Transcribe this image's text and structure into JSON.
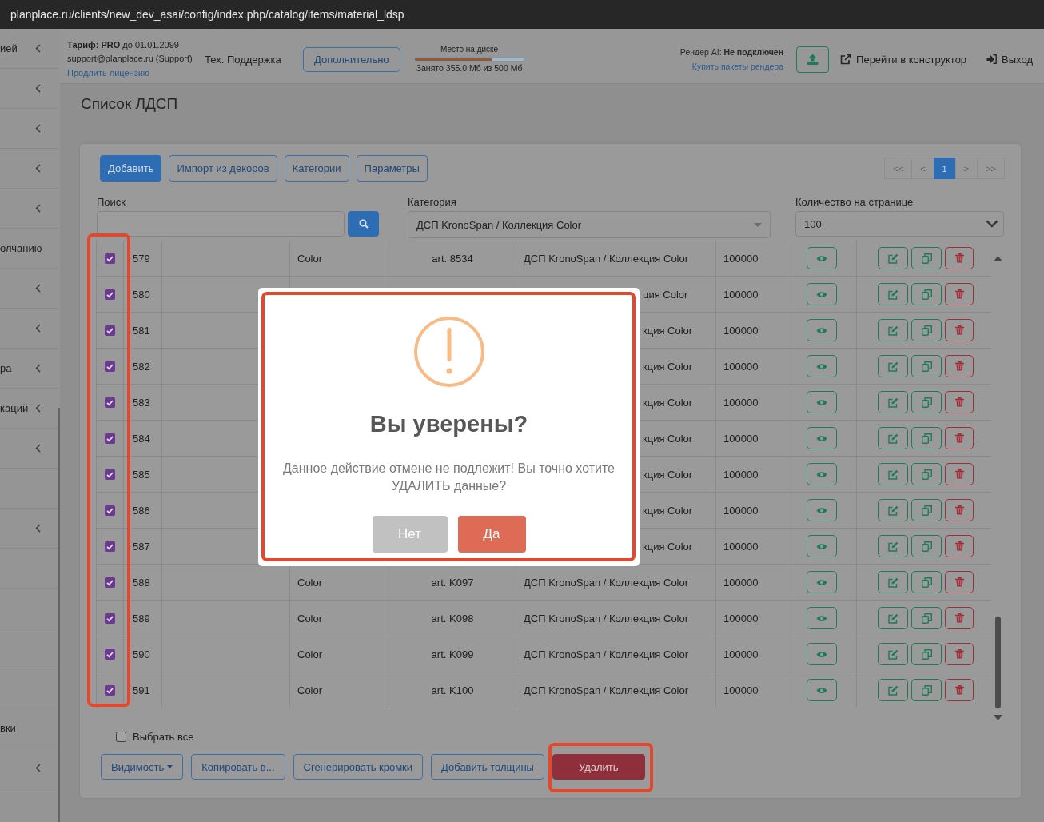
{
  "browser": {
    "url": "planplace.ru/clients/new_dev_asai/config/index.php/catalog/items/material_ldsp"
  },
  "sidebar": {
    "items": [
      {
        "label": "ией",
        "expandable": true
      },
      {
        "expandable": true
      },
      {
        "expandable": true
      },
      {
        "expandable": true
      },
      {
        "expandable": true
      },
      {
        "label": "олчанию",
        "expandable": false
      },
      {
        "expandable": true
      },
      {
        "expandable": true
      },
      {
        "label": "ра",
        "expandable": true
      },
      {
        "label": "каций",
        "expandable": true
      },
      {
        "expandable": true
      },
      {
        "expandable": false
      },
      {
        "expandable": true
      },
      {
        "expandable": false
      },
      {
        "expandable": false
      },
      {
        "expandable": false
      },
      {
        "expandable": false
      },
      {
        "label": "вки",
        "expandable": false
      },
      {
        "expandable": true
      }
    ]
  },
  "header": {
    "plan": "**Тариф: PRO** до 01.01.2099",
    "account": "support@planplace.ru (Support)",
    "renew_link": "Продлить лицензию",
    "support_link": "Тех. Поддержка",
    "more_button": "Дополнительно",
    "disk": {
      "title": "Место на диске",
      "level": 0.71,
      "reading": "Занято 355.0 Мб из 500 Мб"
    },
    "render": {
      "status": "Рендер AI: **Не подключен**",
      "link": "Купить пакеты рендера"
    },
    "constructor_link": "Перейти в конструктор",
    "logout": "Выход"
  },
  "page": {
    "title": "Список ЛДСП"
  },
  "toolbar": {
    "buttons": [
      {
        "label": "Добавить",
        "kind": "primary"
      },
      {
        "label": "Импорт из декоров",
        "kind": "outline"
      },
      {
        "label": "Категории",
        "kind": "outline"
      },
      {
        "label": "Параметры",
        "kind": "outline"
      }
    ],
    "pagination": [
      {
        "label": "<<",
        "selected": false
      },
      {
        "label": "<",
        "selected": false
      },
      {
        "label": "1",
        "selected": true
      },
      {
        "label": ">",
        "selected": false
      },
      {
        "label": ">>",
        "selected": false
      }
    ]
  },
  "filters": {
    "search": {
      "label": "Поиск"
    },
    "category": {
      "label": "Категория",
      "value": "ДСП KronoSpan / Коллекция Color"
    },
    "per_page": {
      "label": "Количество на странице",
      "value": "100"
    }
  },
  "table": {
    "checkbox_column_highlighted": true,
    "rows": [
      {
        "checked": true,
        "id": "579",
        "column_4": "Color",
        "column_5": "art. 8534",
        "column_6": "ДСП KronoSpan / Коллекция Color",
        "column_7": "100000",
        "covered": false
      },
      {
        "checked": true,
        "id": "580",
        "column_6": "ция Color",
        "column_7": "100000",
        "covered": true
      },
      {
        "checked": true,
        "id": "581",
        "column_6": "кция Color",
        "column_7": "100000",
        "covered": true
      },
      {
        "checked": true,
        "id": "582",
        "column_6": "кция Color",
        "column_7": "100000",
        "covered": true
      },
      {
        "checked": true,
        "id": "583",
        "column_6": "кция Color",
        "column_7": "100000",
        "covered": true
      },
      {
        "checked": true,
        "id": "584",
        "column_6": "кция Color",
        "column_7": "100000",
        "covered": true
      },
      {
        "checked": true,
        "id": "585",
        "column_6": "кция Color",
        "column_7": "100000",
        "covered": true
      },
      {
        "checked": true,
        "id": "586",
        "column_6": "кция Color",
        "column_7": "100000",
        "covered": true
      },
      {
        "checked": true,
        "id": "587",
        "column_6": "кция Color",
        "column_7": "100000",
        "covered": true
      },
      {
        "checked": true,
        "id": "588",
        "column_4": "Color",
        "column_5": "art. K097",
        "column_6": "ДСП KronoSpan / Коллекция Color",
        "column_7": "100000",
        "covered": false
      },
      {
        "checked": true,
        "id": "589",
        "column_4": "Color",
        "column_5": "art. K098",
        "column_6": "ДСП KronoSpan / Коллекция Color",
        "column_7": "100000",
        "covered": false
      },
      {
        "checked": true,
        "id": "590",
        "column_4": "Color",
        "column_5": "art. K099",
        "column_6": "ДСП KronoSpan / Коллекция Color",
        "column_7": "100000",
        "covered": false
      },
      {
        "checked": true,
        "id": "591",
        "column_4": "Color",
        "column_5": "art. K100",
        "column_6": "ДСП KronoSpan / Коллекция Color",
        "column_7": "100000",
        "covered": false
      }
    ]
  },
  "select_all": {
    "label": "Выбрать все",
    "checked": false
  },
  "actions": [
    {
      "label": "Видимость",
      "kind": "dropdown",
      "highlighted": false
    },
    {
      "label": "Копировать в...",
      "kind": "outline",
      "highlighted": false
    },
    {
      "label": "Сгенерировать кромки",
      "kind": "outline",
      "highlighted": false
    },
    {
      "label": "Добавить толщины",
      "kind": "outline",
      "highlighted": false
    },
    {
      "label": "Удалить",
      "kind": "danger",
      "highlighted": true
    }
  ],
  "dialog": {
    "highlighted": true,
    "title": "Вы уверены?",
    "message": "Данное действие отмене не подлежит! Вы точно хотите УДАЛИТЬ данные?",
    "buttons": [
      {
        "label": "Нет",
        "kind": "cancel"
      },
      {
        "label": "Да",
        "kind": "confirm"
      }
    ]
  }
}
